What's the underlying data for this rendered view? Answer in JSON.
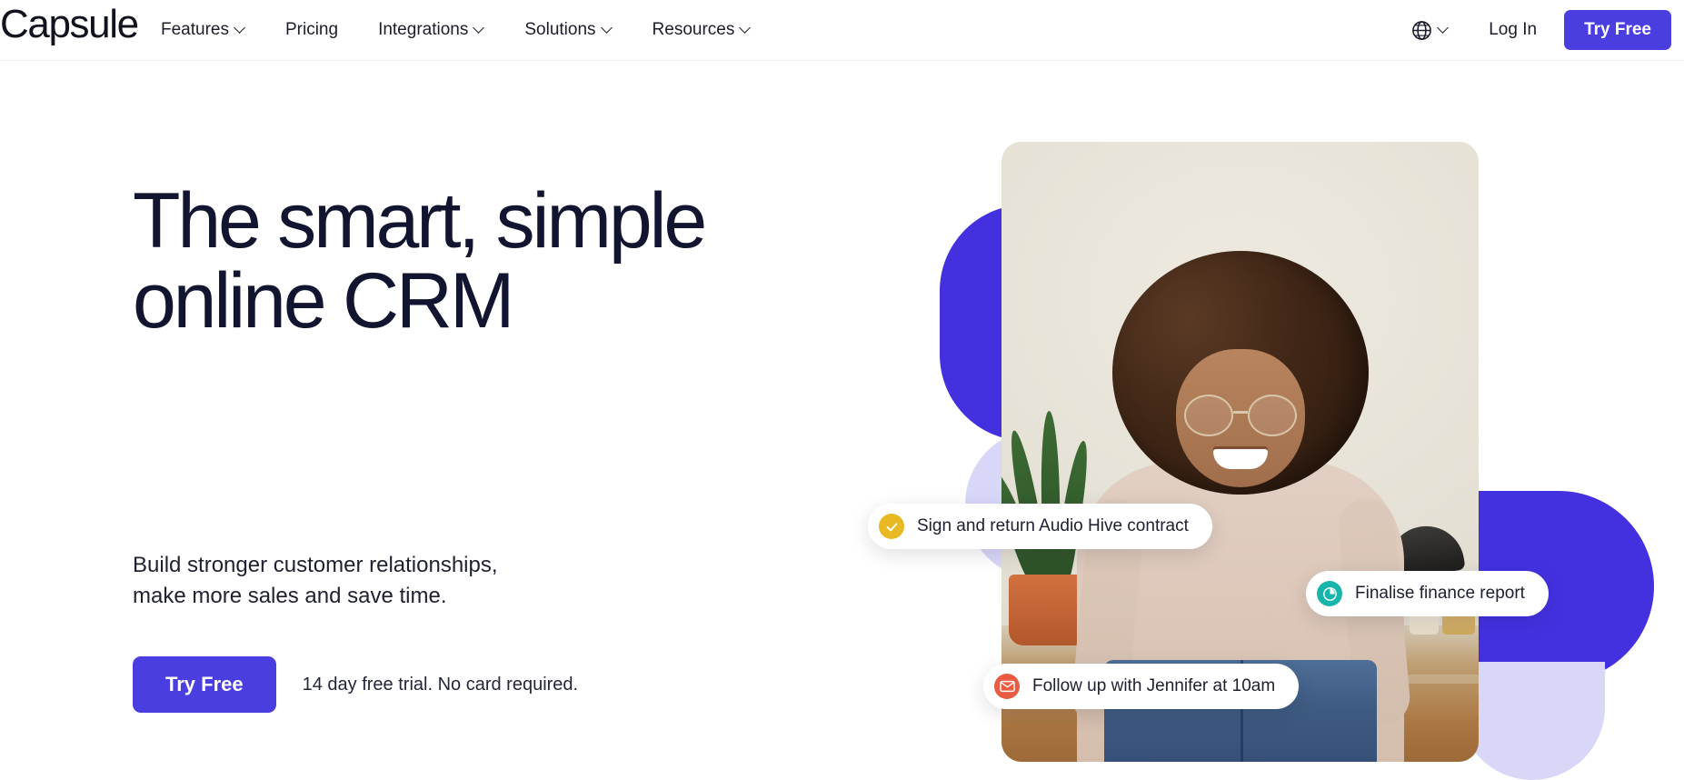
{
  "brand": {
    "name": "Capsule"
  },
  "nav": {
    "items": [
      {
        "label": "Features",
        "has_chevron": true
      },
      {
        "label": "Pricing",
        "has_chevron": false
      },
      {
        "label": "Integrations",
        "has_chevron": true
      },
      {
        "label": "Solutions",
        "has_chevron": true
      },
      {
        "label": "Resources",
        "has_chevron": true
      }
    ],
    "language_icon": "globe-icon",
    "login_label": "Log In",
    "try_free_label": "Try Free"
  },
  "hero": {
    "headline": "The smart, simple\nonline CRM",
    "subheadline": "Build stronger customer relationships,\nmake more sales and save time.",
    "cta_label": "Try Free",
    "trial_note": "14 day free trial. No card required."
  },
  "notifications": [
    {
      "icon": "check-circle-icon",
      "icon_color": "#e8b923",
      "text": "Sign and return Audio Hive contract"
    },
    {
      "icon": "pie-chart-icon",
      "icon_color": "#18b5ac",
      "text": "Finalise finance report"
    },
    {
      "icon": "envelope-icon",
      "icon_color": "#e95c41",
      "text": "Follow up with Jennifer at 10am"
    }
  ],
  "colors": {
    "accent_purple": "#4a3ee0",
    "blob_purple": "#4331e0",
    "blob_lavender": "#d9d7f8",
    "headline_navy": "#121530",
    "page_background": "#ffffff"
  }
}
